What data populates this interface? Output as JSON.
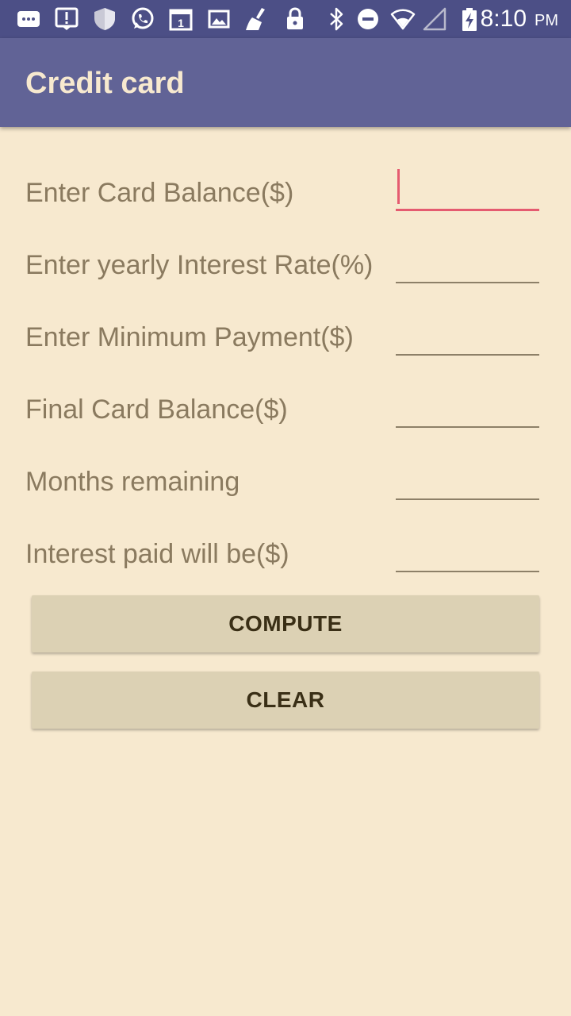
{
  "status_bar": {
    "time": "8:10",
    "ampm": "PM",
    "icons": [
      "chat-icon",
      "alert-icon",
      "shield-icon",
      "whatsapp-icon",
      "calendar-icon",
      "image-icon",
      "broom-icon",
      "lock-icon",
      "bluetooth-icon",
      "do-not-disturb-icon",
      "wifi-icon",
      "signal-icon",
      "battery-charging-icon"
    ],
    "calendar_day": "1"
  },
  "app_bar": {
    "title": "Credit card"
  },
  "form": {
    "fields": [
      {
        "label": "Enter Card Balance($)",
        "value": ""
      },
      {
        "label": "Enter yearly Interest Rate(%)",
        "value": ""
      },
      {
        "label": "Enter Minimum Payment($)",
        "value": ""
      },
      {
        "label": "Final Card Balance($)",
        "value": ""
      },
      {
        "label": "Months remaining",
        "value": ""
      },
      {
        "label": "Interest paid will be($)",
        "value": ""
      }
    ]
  },
  "buttons": {
    "compute": "COMPUTE",
    "clear": "CLEAR"
  },
  "colors": {
    "background": "#f7e9cf",
    "status_bar": "#4c4f86",
    "app_bar": "#616396",
    "accent": "#e55b70",
    "label_text": "#8a7a5f",
    "button": "#dcd1b4"
  }
}
